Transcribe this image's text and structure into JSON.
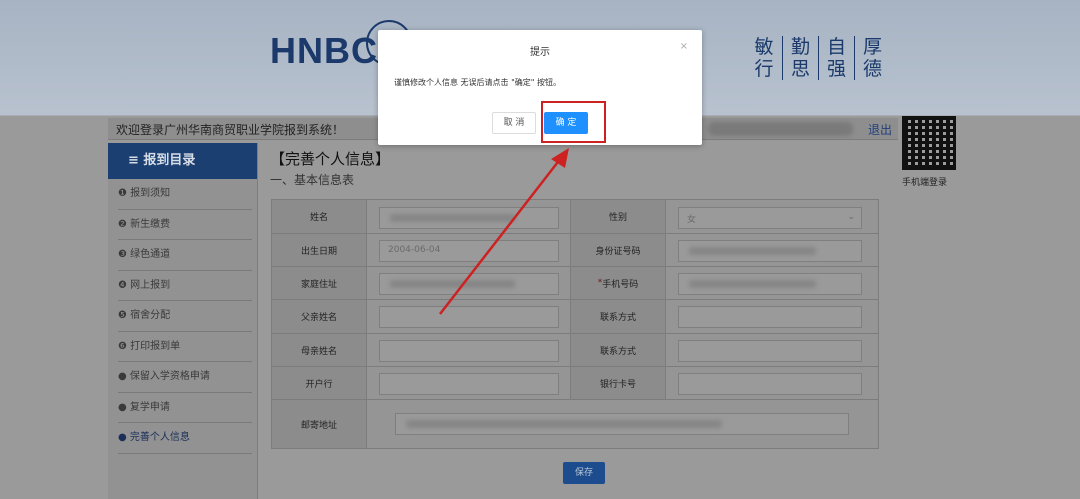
{
  "header": {
    "logo_text": "HNBC",
    "motto": [
      [
        "敏",
        "行"
      ],
      [
        "勤",
        "思"
      ],
      [
        "自",
        "强"
      ],
      [
        "厚",
        "德"
      ]
    ]
  },
  "welcome": {
    "text": "欢迎登录广州华南商贸职业学院报到系统！",
    "logout": "退出"
  },
  "qr": {
    "label": "手机端登录"
  },
  "sidebar": {
    "title": "≡ 报到目录",
    "items": [
      "❶ 报到须知",
      "❷ 新生缴费",
      "❸ 绿色通道",
      "❹ 网上报到",
      "❺ 宿舍分配",
      "❻ 打印报到单",
      "● 保留入学资格申请",
      "● 复学申请",
      "● 完善个人信息"
    ],
    "active_index": 8
  },
  "content": {
    "title": "【完善个人信息】",
    "subtitle": "一、基本信息表"
  },
  "form": {
    "rows": [
      {
        "label1": "姓名",
        "value1": "",
        "label2": "性别",
        "value2": "女"
      },
      {
        "label1": "出生日期",
        "value1": "2004-06-04",
        "label2": "身份证号码",
        "value2": ""
      },
      {
        "label1": "家庭住址",
        "value1": "",
        "label2_req": "*",
        "label2": "手机号码",
        "value2": ""
      },
      {
        "label1": "父亲姓名",
        "value1": "",
        "label2": "联系方式",
        "value2": ""
      },
      {
        "label1": "母亲姓名",
        "value1": "",
        "label2": "联系方式",
        "value2": ""
      },
      {
        "label1": "开户行",
        "value1": "",
        "label2": "银行卡号",
        "value2": ""
      }
    ],
    "address_label": "邮寄地址",
    "save_label": "保存"
  },
  "modal": {
    "title": "提示",
    "close": "×",
    "message": "谨慎修改个人信息 无误后请点击 \"确定\" 按钮。",
    "cancel": "取 消",
    "ok": "确 定"
  },
  "colors": {
    "primary": "#1e90ff",
    "nav_header": "#1c3f72",
    "annotation": "#cc2222"
  }
}
